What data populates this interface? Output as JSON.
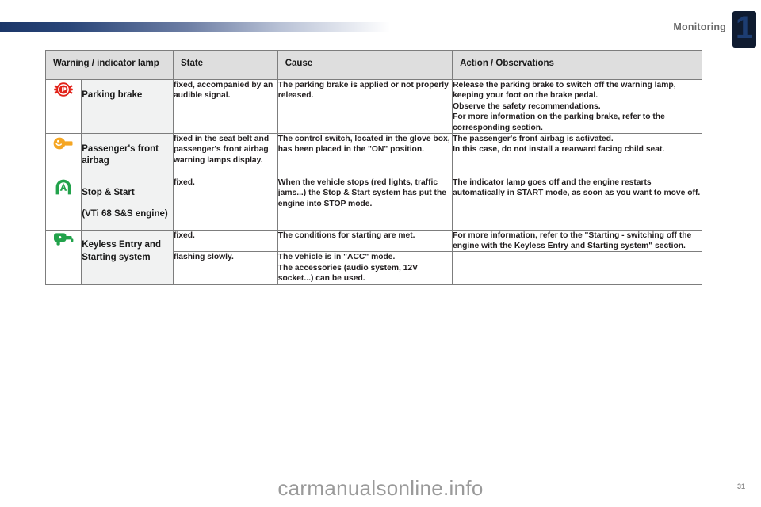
{
  "header": {
    "chapter_number": "1",
    "chapter_title": "Monitoring",
    "accent_color": "#1d3d72"
  },
  "table": {
    "columns": [
      {
        "key": "lamp",
        "label": "Warning / indicator lamp"
      },
      {
        "key": "state",
        "label": "State"
      },
      {
        "key": "cause",
        "label": "Cause"
      },
      {
        "key": "action",
        "label": "Action / Observations"
      }
    ],
    "rows": [
      {
        "icon": "parking-brake-icon",
        "icon_color": "#e2231a",
        "name": "Parking brake",
        "state": "fixed, accompanied by an audible signal.",
        "cause": "The parking brake is applied or not properly released.",
        "action": "Release the parking brake to switch off the warning lamp, keeping your foot on the brake pedal.\nObserve the safety recommendations.\nFor more information on the parking brake, refer to the corresponding section."
      },
      {
        "icon": "passenger-airbag-icon",
        "icon_color": "#f5a623",
        "name": "Passenger's front airbag",
        "state": "fixed in the seat belt and passenger's front airbag warning lamps display.",
        "cause": "The control switch, located in the glove box, has been placed in the \"ON\" position.",
        "action": "The passenger's front airbag is activated.\nIn this case, do not install a rearward facing child seat."
      },
      {
        "icon": "stop-start-icon",
        "icon_color": "#22a24b",
        "name": "Stop & Start\n(VTi 68 S&S engine)",
        "state": "fixed.",
        "cause": "When the vehicle stops (red lights, traffic jams...) the Stop & Start system has put the engine into STOP mode.",
        "action": "The indicator lamp goes off and the engine restarts automatically in START mode, as soon as you want to move off."
      },
      {
        "icon": "keyless-entry-icon",
        "icon_color": "#22a24b",
        "name": "Keyless Entry and Starting system",
        "state": "fixed.",
        "cause": "The conditions for starting are met.",
        "action": "For more information, refer to the \"Starting - switching off the engine with the Keyless Entry and Starting system\" section."
      },
      {
        "icon": "",
        "icon_color": "",
        "name": "",
        "state": "flashing slowly.",
        "cause": "The vehicle is in \"ACC\" mode.\nThe accessories (audio system, 12V socket...) can be used.",
        "action": ""
      }
    ]
  },
  "footer": {
    "watermark": "carmanualsonline.info",
    "page_number": "31"
  }
}
